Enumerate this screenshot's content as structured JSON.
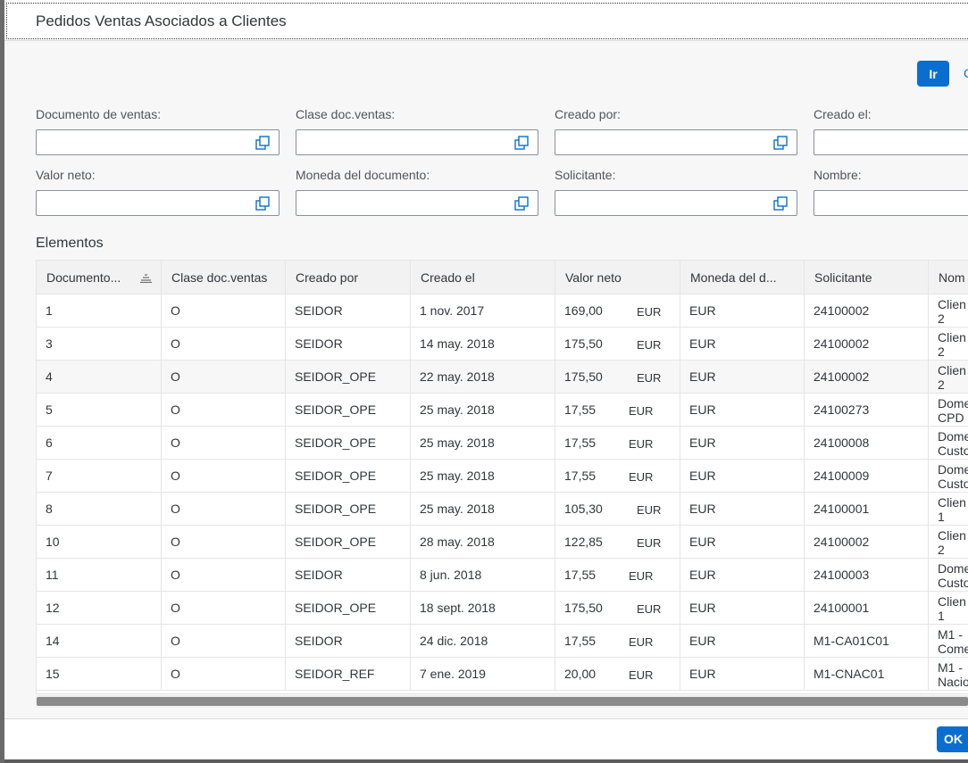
{
  "dialog": {
    "title": "Pedidos Ventas Asociados a Clientes",
    "go_label": "Ir",
    "ok_label": "OK"
  },
  "filters": [
    {
      "label": "Documento de ventas:",
      "value": ""
    },
    {
      "label": "Clase doc.ventas:",
      "value": ""
    },
    {
      "label": "Creado por:",
      "value": ""
    },
    {
      "label": "Creado el:",
      "value": ""
    },
    {
      "label": "Valor neto:",
      "value": ""
    },
    {
      "label": "Moneda del documento:",
      "value": ""
    },
    {
      "label": "Solicitante:",
      "value": ""
    },
    {
      "label": "Nombre:",
      "value": ""
    }
  ],
  "table": {
    "section_title": "Elementos",
    "columns": [
      "Documento...",
      "Clase doc.ventas",
      "Creado por",
      "Creado el",
      "Valor neto",
      "Moneda del d...",
      "Solicitante",
      "Nom"
    ],
    "rows": [
      {
        "doc": "1",
        "clase": "O",
        "creado_por": "SEIDOR",
        "creado_el": "1 nov. 2017",
        "valor": "169,00",
        "cur": "EUR",
        "moneda": "EUR",
        "solicitante": "24100002",
        "nombre_1": "Clien",
        "nombre_2": "2"
      },
      {
        "doc": "3",
        "clase": "O",
        "creado_por": "SEIDOR",
        "creado_el": "14 may. 2018",
        "valor": "175,50",
        "cur": "EUR",
        "moneda": "EUR",
        "solicitante": "24100002",
        "nombre_1": "Clien",
        "nombre_2": "2"
      },
      {
        "doc": "4",
        "clase": "O",
        "creado_por": "SEIDOR_OPE",
        "creado_el": "22 may. 2018",
        "valor": "175,50",
        "cur": "EUR",
        "moneda": "EUR",
        "solicitante": "24100002",
        "nombre_1": "Clien",
        "nombre_2": "2"
      },
      {
        "doc": "5",
        "clase": "O",
        "creado_por": "SEIDOR_OPE",
        "creado_el": "25 may. 2018",
        "valor": "17,55",
        "cur": "EUR",
        "moneda": "EUR",
        "solicitante": "24100273",
        "nombre_1": "Dome",
        "nombre_2": "CPD"
      },
      {
        "doc": "6",
        "clase": "O",
        "creado_por": "SEIDOR_OPE",
        "creado_el": "25 may. 2018",
        "valor": "17,55",
        "cur": "EUR",
        "moneda": "EUR",
        "solicitante": "24100008",
        "nombre_1": "Dome",
        "nombre_2": "Custo"
      },
      {
        "doc": "7",
        "clase": "O",
        "creado_por": "SEIDOR_OPE",
        "creado_el": "25 may. 2018",
        "valor": "17,55",
        "cur": "EUR",
        "moneda": "EUR",
        "solicitante": "24100009",
        "nombre_1": "Dome",
        "nombre_2": "Custo"
      },
      {
        "doc": "8",
        "clase": "O",
        "creado_por": "SEIDOR_OPE",
        "creado_el": "25 may. 2018",
        "valor": "105,30",
        "cur": "EUR",
        "moneda": "EUR",
        "solicitante": "24100001",
        "nombre_1": "Clien",
        "nombre_2": "1"
      },
      {
        "doc": "10",
        "clase": "O",
        "creado_por": "SEIDOR_OPE",
        "creado_el": "28 may. 2018",
        "valor": "122,85",
        "cur": "EUR",
        "moneda": "EUR",
        "solicitante": "24100002",
        "nombre_1": "Clien",
        "nombre_2": "2"
      },
      {
        "doc": "11",
        "clase": "O",
        "creado_por": "SEIDOR",
        "creado_el": "8 jun. 2018",
        "valor": "17,55",
        "cur": "EUR",
        "moneda": "EUR",
        "solicitante": "24100003",
        "nombre_1": "Dome",
        "nombre_2": "Custo"
      },
      {
        "doc": "12",
        "clase": "O",
        "creado_por": "SEIDOR_OPE",
        "creado_el": "18 sept. 2018",
        "valor": "175,50",
        "cur": "EUR",
        "moneda": "EUR",
        "solicitante": "24100001",
        "nombre_1": "Clien",
        "nombre_2": "1"
      },
      {
        "doc": "14",
        "clase": "O",
        "creado_por": "SEIDOR",
        "creado_el": "24 dic. 2018",
        "valor": "17,55",
        "cur": "EUR",
        "moneda": "EUR",
        "solicitante": "M1-CA01C01",
        "nombre_1": "M1 -",
        "nombre_2": "Come"
      },
      {
        "doc": "15",
        "clase": "O",
        "creado_por": "SEIDOR_REF",
        "creado_el": "7 ene. 2019",
        "valor": "20,00",
        "cur": "EUR",
        "moneda": "EUR",
        "solicitante": "M1-CNAC01",
        "nombre_1": "M1 -",
        "nombre_2": "Nacio"
      }
    ]
  },
  "colors": {
    "accent": "#0a6ed1",
    "background": "#f7f7f7"
  }
}
